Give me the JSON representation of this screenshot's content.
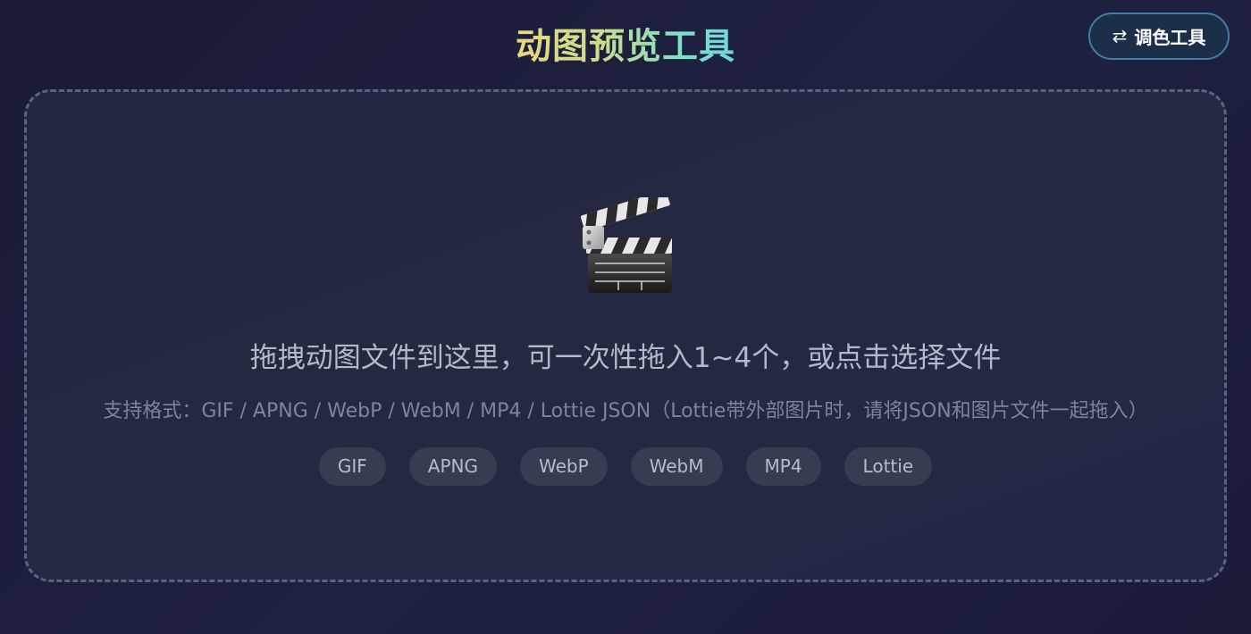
{
  "header": {
    "title": "动图预览工具",
    "palette_button": {
      "icon": "swap-arrows-icon",
      "icon_glyph": "⇄",
      "label": "调色工具"
    }
  },
  "drop_zone": {
    "icon": "clapper-board-icon",
    "hint": "拖拽动图文件到这里，可一次性拖入1~4个，或点击选择文件",
    "formats_note": "支持格式：GIF / APNG / WebP / WebM / MP4 / Lottie JSON（Lottie带外部图片时，请将JSON和图片文件一起拖入）",
    "format_chips": [
      "GIF",
      "APNG",
      "WebP",
      "WebM",
      "MP4",
      "Lottie"
    ]
  },
  "colors": {
    "background": "#1d1f3b",
    "title_gradient_start": "#e9d77e",
    "title_gradient_end": "#6fd8d8",
    "button_border": "#3f7fa3",
    "dashed_border": "#5a6380",
    "chip_background": "#383c53"
  }
}
